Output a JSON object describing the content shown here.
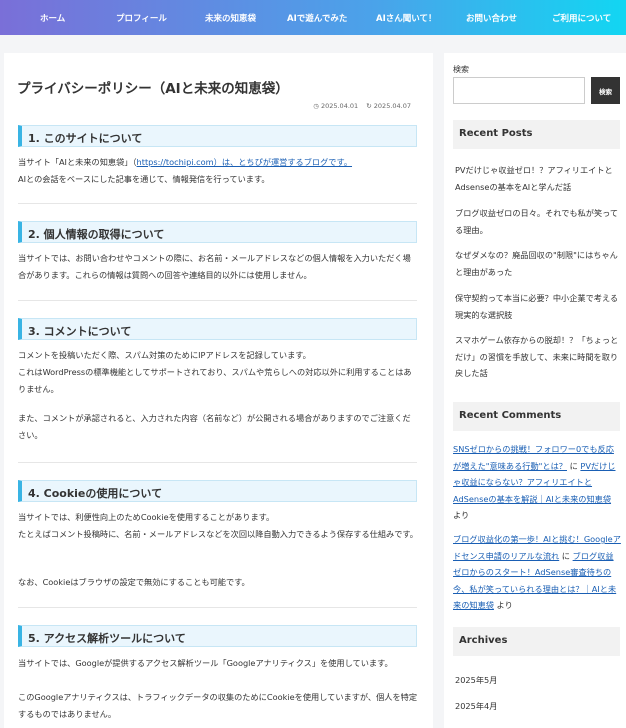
{
  "nav": [
    {
      "label": "ホーム"
    },
    {
      "label": "プロフィール"
    },
    {
      "label": "未来の知恵袋"
    },
    {
      "label": "AIで遊んでみた"
    },
    {
      "label": "AIさん聞いて！"
    },
    {
      "label": "お問い合わせ"
    },
    {
      "label": "ご利用について"
    }
  ],
  "article": {
    "title": "プライバシーポリシー（AIと未来の知恵袋）",
    "published": "2025.04.01",
    "updated": "2025.04.07",
    "sections": [
      {
        "heading": "1. このサイトについて",
        "p1_pre": "当サイト「AIと未来の知恵袋」（",
        "p1_link": "https://tochipi.com）は、とちぴが運営するブログです。",
        "p1_post": "AIとの会話をベースにした記事を通じて、情報発信を行っています。"
      },
      {
        "heading": "2. 個人情報の取得について",
        "p1": "当サイトでは、お問い合わせやコメントの際に、お名前・メールアドレスなどの個人情報を入力いただく場合があります。これらの情報は質問への回答や連絡目的以外には使用しません。"
      },
      {
        "heading": "3. コメントについて",
        "p1": "コメントを投稿いただく際、スパム対策のためにIPアドレスを記録しています。",
        "p2": "これはWordPressの標準機能としてサポートされており、スパムや荒らしへの対応以外に利用することはありません。",
        "p3": "また、コメントが承認されると、入力された内容（名前など）が公開される場合がありますのでご注意ください。"
      },
      {
        "heading": "4. Cookieの使用について",
        "p1": "当サイトでは、利便性向上のためCookieを使用することがあります。",
        "p2": "たとえばコメント投稿時に、名前・メールアドレスなどを次回以降自動入力できるよう保存する仕組みです。",
        "p3": "なお、Cookieはブラウザの設定で無効にすることも可能です。"
      },
      {
        "heading": "5. アクセス解析ツールについて",
        "p1": "当サイトでは、Googleが提供するアクセス解析ツール「Googleアナリティクス」を使用しています。",
        "p2": "このGoogleアナリティクスは、トラフィックデータの収集のためにCookieを使用していますが、個人を特定するものではありません。"
      }
    ]
  },
  "sidebar": {
    "search_label": "検索",
    "search_button": "検索",
    "search_value": "",
    "recent_posts_title": "Recent Posts",
    "recent_posts": [
      "PVだけじゃ収益ゼロ！？アフィリエイトとAdsenseの基本をAIと学んだ話",
      "ブログ収益ゼロの日々。それでも私が笑ってる理由。",
      "なぜダメなの？廃品回収の\"制限\"にはちゃんと理由があった",
      "保守契約って本当に必要？中小企業で考える現実的な選択肢",
      "スマホゲーム依存からの脱却！？「ちょっとだけ」の習慣を手放して、未来に時間を取り戻した話"
    ],
    "recent_comments_title": "Recent Comments",
    "comment1": {
      "author_link": "SNSゼロからの挑戦！フォロワー0でも反応が増えた\"意味ある行動\"とは？",
      "on": " に ",
      "post_link": "PVだけじゃ収益にならない？アフィリエイトとAdSenseの基本を解説｜AIと未来の知恵袋",
      "by": " より"
    },
    "comment2": {
      "author_link": "ブログ収益化の第一歩！AIと挑む！Googleアドセンス申請のリアルな流れ",
      "on": " に ",
      "post_link": "ブログ収益ゼロからのスタート！AdSense審査待ちの今、私が笑っていられる理由とは？｜AIと未来の知恵袋",
      "by": " より"
    },
    "archives_title": "Archives",
    "archives": [
      "2025年5月",
      "2025年4月"
    ]
  },
  "colors": {
    "nav_gradient_start": "#7a6fd8",
    "nav_gradient_end": "#12d6f2",
    "heading_accent": "#39b4e4",
    "link": "#1a5fb4"
  }
}
